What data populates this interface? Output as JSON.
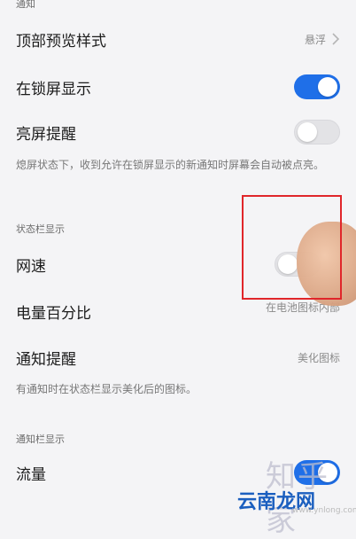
{
  "sections": {
    "notify_label": "通知",
    "statusbar_label": "状态栏显示",
    "notify_display_label": "通知栏显示"
  },
  "rows": {
    "top_preview": {
      "title": "顶部预览样式",
      "value": "悬浮"
    },
    "lockscreen": {
      "title": "在锁屏显示",
      "state": "on"
    },
    "wake_screen": {
      "title": "亮屏提醒",
      "state": "off"
    },
    "wake_hint": "熄屏状态下，收到允许在锁屏显示的新通知时屏幕会自动被点亮。",
    "net_speed": {
      "title": "网速",
      "state": "off"
    },
    "battery": {
      "title": "电量百分比",
      "value": "在电池图标内部"
    },
    "notify_remind": {
      "title": "通知提醒",
      "value": "美化图标"
    },
    "notify_hint": "有通知时在状态栏显示美化后的图标。",
    "traffic": {
      "title": "流量",
      "state": "on"
    }
  },
  "watermark": {
    "text1": "知乎家",
    "text2": "云南龙网",
    "url": "www.ynlong.com"
  },
  "colors": {
    "toggle_on": "#1f6fe8",
    "highlight_box": "#e0262a"
  }
}
